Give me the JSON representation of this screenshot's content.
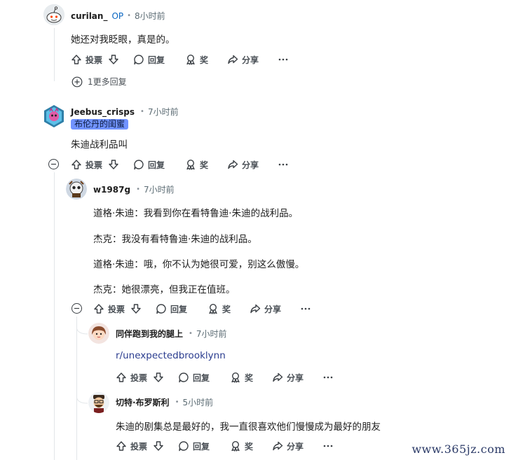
{
  "comments": [
    {
      "author": "curilan_",
      "op_badge": "OP",
      "time": "8小时前",
      "text": [
        "她还对我眨眼，真是的。"
      ],
      "actions": {
        "upvote": "投票",
        "reply": "回复",
        "award": "奖",
        "share": "分享"
      }
    },
    {
      "author": "Jeebus_crisps",
      "time": "7小时前",
      "flair": "布伦丹的闺蜜",
      "text": [
        "朱迪战利品叫"
      ],
      "actions": {
        "upvote": "投票",
        "reply": "回复",
        "award": "奖",
        "share": "分享"
      }
    },
    {
      "author": "w1987g",
      "time": "7小时前",
      "text": [
        "道格·朱迪：我看到你在看特鲁迪·朱迪的战利品。",
        "杰克：我没有看特鲁迪·朱迪的战利品。",
        "道格·朱迪：哦，你不认为她很可爱，别这么傲慢。",
        "杰克：她很漂亮，但我正在值班。"
      ],
      "actions": {
        "upvote": "投票",
        "reply": "回复",
        "award": "奖",
        "share": "分享"
      }
    },
    {
      "author": "同伴跑到我的腿上",
      "time": "7小时前",
      "text": [
        "r/unexpectedbrooklynn"
      ],
      "actions": {
        "upvote": "投票",
        "reply": "回复",
        "award": "奖",
        "share": "分享"
      }
    },
    {
      "author": "切特·布罗斯利",
      "time": "5小时前",
      "text": [
        "朱迪的剧集总是最好的，我一直很喜欢他们慢慢成为最好的朋友"
      ],
      "actions": {
        "upvote": "投票",
        "reply": "回复",
        "award": "奖",
        "share": "分享"
      }
    }
  ],
  "more_replies": "1更多回复",
  "dot": "•",
  "watermark": "www.365jz.com",
  "colors": {
    "flair_bg": "#7193ff",
    "op": "#0a66c2",
    "thread_line": "#e2e6e9"
  }
}
